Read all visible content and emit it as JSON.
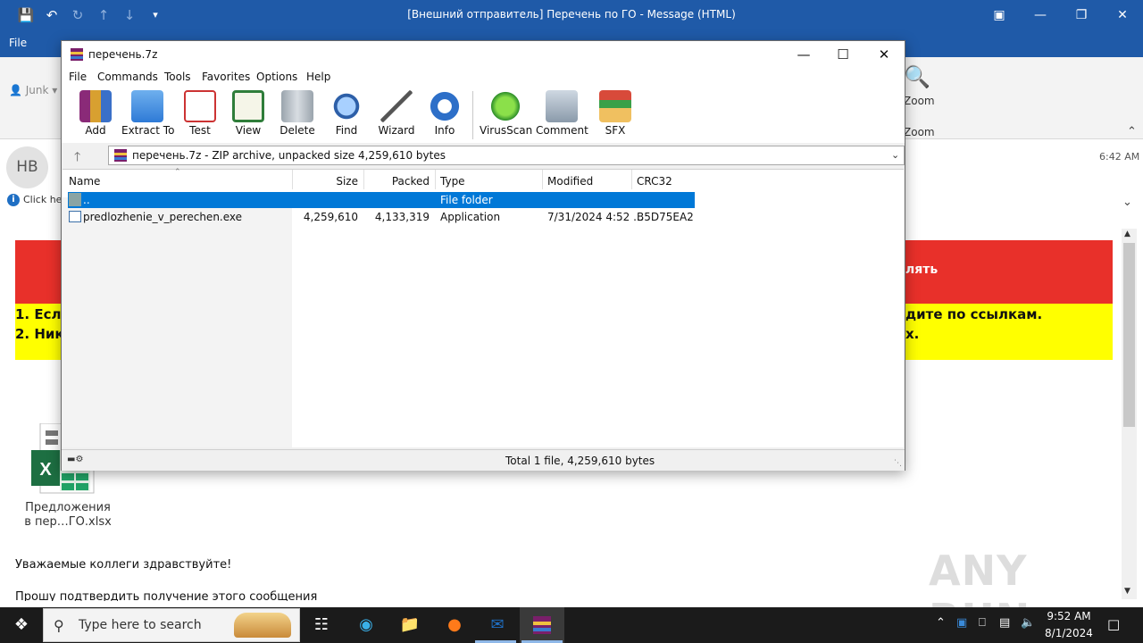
{
  "outlook": {
    "title": "[Внешний отправитель] Перечень по ГО  -  Message (HTML)",
    "file_tab": "File",
    "junk_label": "Junk",
    "zoom_label": "Zoom",
    "zoom_group": "Zoom",
    "sender_initials": "HB",
    "click_here": "Click her",
    "time": "6:42 AM",
    "banner_red_fragment": "лять",
    "banner_line1_left": "1. Есл",
    "banner_line1_right": "дите по ссылкам.",
    "banner_line2_left": "2. Ник",
    "banner_line2_right": "х.",
    "attachment_line1": "Предложения",
    "attachment_line2": "в пер…ГО.xlsx",
    "greeting": "Уважаемые коллеги здравствуйте!",
    "greeting2": "Прошу подтвердить получение этого сообщения",
    "watermark": "ANY RUN"
  },
  "winrar": {
    "title": "перечень.7z",
    "menu": [
      "File",
      "Commands",
      "Tools",
      "Favorites",
      "Options",
      "Help"
    ],
    "toolbar": [
      "Add",
      "Extract To",
      "Test",
      "View",
      "Delete",
      "Find",
      "Wizard",
      "Info",
      "VirusScan",
      "Comment",
      "SFX"
    ],
    "address": "перечень.7z - ZIP archive, unpacked size 4,259,610 bytes",
    "columns": [
      "Name",
      "Size",
      "Packed",
      "Type",
      "Modified",
      "CRC32"
    ],
    "rows": [
      {
        "name": "..",
        "size": "",
        "packed": "",
        "type": "File folder",
        "modified": "",
        "crc": ""
      },
      {
        "name": "predlozhenie_v_perechen.exe",
        "size": "4,259,610",
        "packed": "4,133,319",
        "type": "Application",
        "modified": "7/31/2024 4:52 ...",
        "crc": "B5D75EA2"
      }
    ],
    "status": "Total 1 file, 4,259,610 bytes"
  },
  "taskbar": {
    "search_placeholder": "Type here to search",
    "time": "9:52 AM",
    "date": "8/1/2024"
  },
  "colors": {
    "outlook_blue": "#1f5aa8",
    "banner_red": "#e8302a",
    "banner_yellow": "#ffff00",
    "selection": "#0078d7",
    "taskbar": "#1b1b1b"
  }
}
